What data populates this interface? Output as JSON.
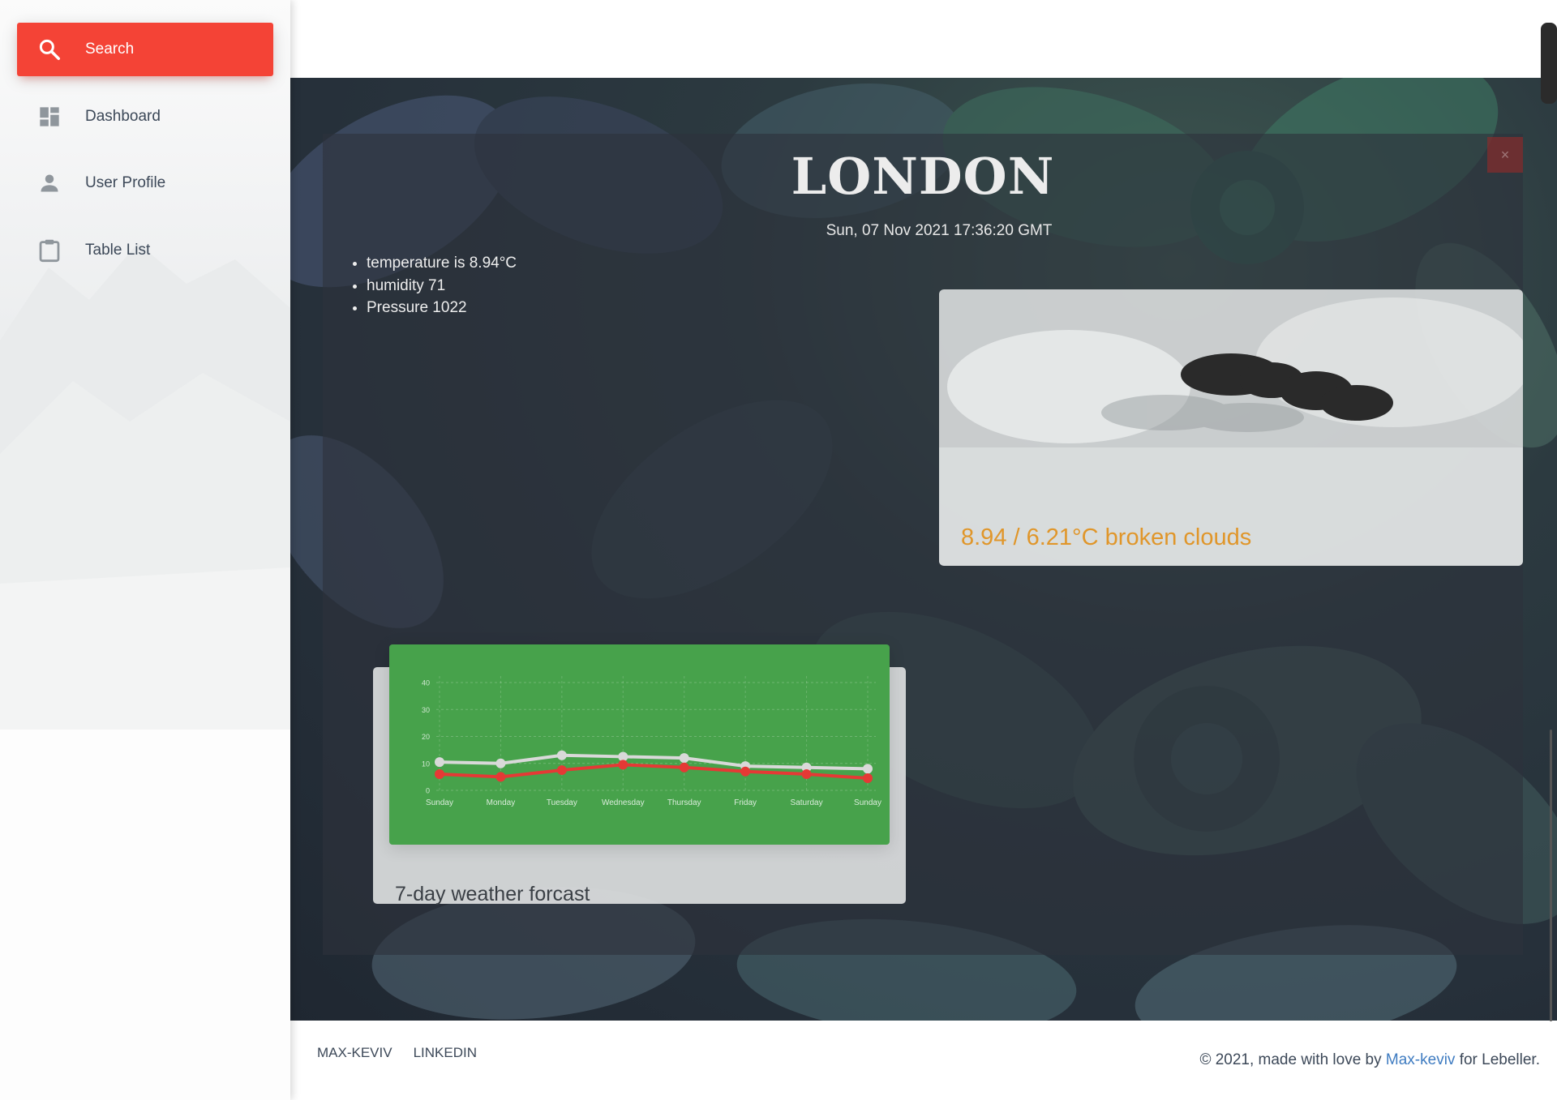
{
  "sidebar": {
    "items": [
      {
        "label": "Search",
        "icon": "search-icon",
        "active": true
      },
      {
        "label": "Dashboard",
        "icon": "dashboard-icon",
        "active": false
      },
      {
        "label": "User Profile",
        "icon": "person-icon",
        "active": false
      },
      {
        "label": "Table List",
        "icon": "clipboard-icon",
        "active": false
      }
    ],
    "accent": "#f44336"
  },
  "weather": {
    "city": "LONDON",
    "datetime": "Sun, 07 Nov 2021 17:36:20 GMT",
    "close_label": "×",
    "stats": [
      "temperature is 8.94°C",
      "humidity 71",
      "Pressure 1022"
    ],
    "summary": "8.94 / 6.21°C broken clouds",
    "icon": "broken-clouds-icon"
  },
  "forecast": {
    "caption": "7-day weather forcast",
    "chart_data": {
      "type": "line",
      "categories": [
        "Sunday",
        "Monday",
        "Tuesday",
        "Wednesday",
        "Thursday",
        "Friday",
        "Saturday",
        "Sunday"
      ],
      "series": [
        {
          "values": [
            10.5,
            10,
            13,
            12.5,
            12,
            9,
            8.5,
            8
          ],
          "color": "#d9d9d9"
        },
        {
          "values": [
            6,
            5,
            7.5,
            9.5,
            8.5,
            7,
            6,
            4.5
          ],
          "color": "#e53935"
        }
      ],
      "ylim": [
        0,
        40
      ],
      "yticks": [
        "0",
        "10",
        "20",
        "30",
        "40"
      ],
      "grid": true,
      "background": "#47a24b"
    }
  },
  "footer": {
    "links": [
      "MAX-KEVIV",
      "LINKEDIN"
    ],
    "copyright_prefix": "© 2021, made with love by ",
    "author": "Max-keviv",
    "copyright_suffix": " for Lebeller.",
    "link_color": "#3f7cc1"
  }
}
